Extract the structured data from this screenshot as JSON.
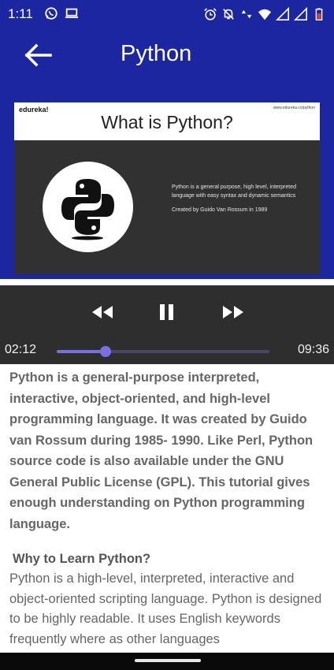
{
  "status_bar": {
    "time": "1:11",
    "icons": [
      "whatsapp-icon",
      "laptop-icon",
      "alarm-icon",
      "mute-icon",
      "data-icon",
      "wifi-icon",
      "signal-icon",
      "signal-icon",
      "battery-icon"
    ]
  },
  "app_bar": {
    "title": "Python",
    "back_icon": "arrow-back-icon"
  },
  "video": {
    "slide": {
      "brand": "edureka!",
      "url": "www.edureka.co/python",
      "title": "What is Python?",
      "bullet1": "Python is a general purpose, high level, interpreted language with easy syntax and dynamic semantics",
      "bullet2": "Created by Guido Van Rossum in 1989"
    }
  },
  "player": {
    "current_time": "02:12",
    "total_time": "09:36",
    "progress": 0.23
  },
  "content": {
    "intro": "Python is a general-purpose interpreted, interactive, object-oriented, and high-level programming language. It was created by Guido van Rossum during 1985- 1990. Like Perl, Python source code is also available under the GNU General Public License (GPL). This tutorial gives enough understanding on Python programming language.",
    "heading": "Why to Learn Python?",
    "body": "Python is a high-level, interpreted, interactive and object-oriented scripting language. Python is designed to be highly readable. It uses English keywords frequently where as other languages"
  },
  "colors": {
    "primary": "#1c26a0",
    "player_bg": "#2e2e2e",
    "accent": "#7b6fe0"
  }
}
